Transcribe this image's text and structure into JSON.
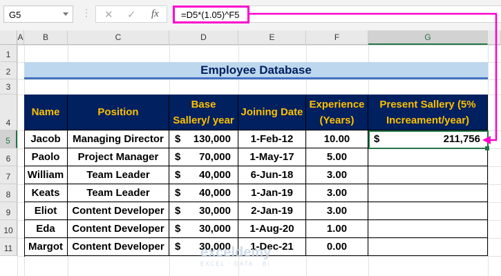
{
  "name_box": "G5",
  "formula": "=D5*(1.05)^F5",
  "fx_label": "fx",
  "columns": [
    "A",
    "B",
    "C",
    "D",
    "E",
    "F",
    "G"
  ],
  "rows": [
    "1",
    "2",
    "3",
    "4",
    "5",
    "6",
    "7",
    "8",
    "9",
    "10",
    "11"
  ],
  "title": "Employee Database",
  "headers": [
    "Name",
    "Position",
    "Base Sallery/ year",
    "Joining Date",
    "Experience (Years)",
    "Present Sallery (5% Increament/year)"
  ],
  "currency": "$",
  "data": [
    [
      "Jacob",
      "Managing Director",
      "130,000",
      "1-Feb-12",
      "10.00",
      "211,756"
    ],
    [
      "Paolo",
      "Project Manager",
      "70,000",
      "1-May-17",
      "5.00",
      ""
    ],
    [
      "William",
      "Team Leader",
      "40,000",
      "6-Jun-18",
      "3.00",
      ""
    ],
    [
      "Keats",
      "Team Leader",
      "40,000",
      "1-Jan-19",
      "3.00",
      ""
    ],
    [
      "Eliot",
      "Content Developer",
      "30,000",
      "2-Jan-19",
      "3.00",
      ""
    ],
    [
      "Eda",
      "Content Developer",
      "30,000",
      "1-Aug-20",
      "1.00",
      ""
    ],
    [
      "Margot",
      "Content Developer",
      "30,000",
      "1-Dec-21",
      "0.00",
      ""
    ]
  ],
  "watermark": "exceldemy EXCEL · DATA · BI",
  "colors": {
    "header_bg": "#002060",
    "header_text": "#ffc000",
    "title_bg": "#bdd7ee",
    "arrow": "#ff00cc"
  }
}
